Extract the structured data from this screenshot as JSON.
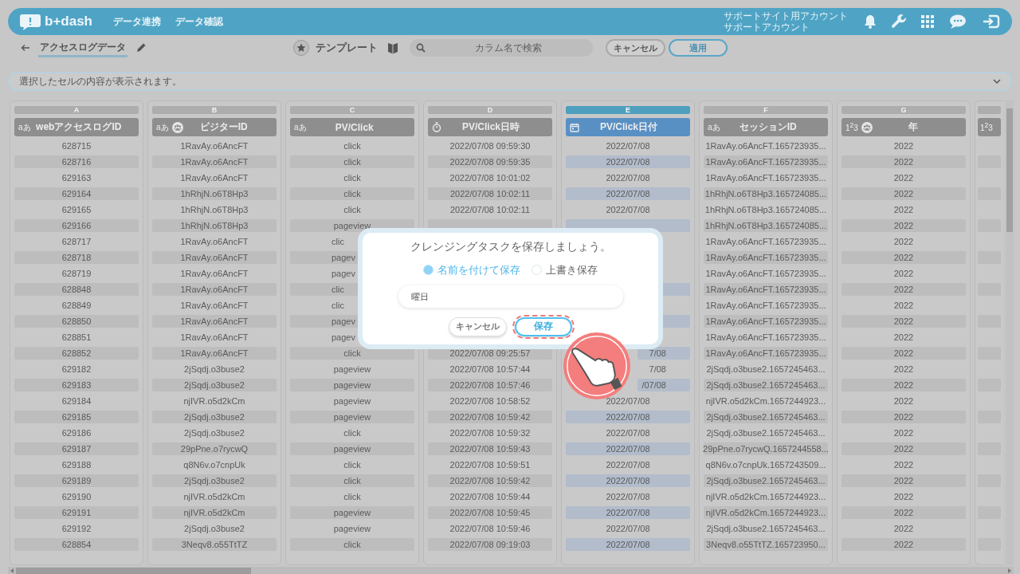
{
  "header": {
    "logo": "b+dash",
    "menu": [
      "データ連携",
      "データ確認"
    ],
    "account": [
      "サポートサイト用アカウント",
      "サポートアカウント"
    ]
  },
  "toolbar": {
    "dataset": "アクセスログデータ",
    "template": "テンプレート",
    "search": {
      "placeholder": "カラム名で検索"
    },
    "buttons": [
      {
        "label": "キャンセル",
        "kind": "plain"
      },
      {
        "label": "適用",
        "kind": "primary"
      }
    ]
  },
  "cell_viewer": {
    "placeholder": "選択したセルの内容が表示されます。"
  },
  "columns": [
    {
      "letter": "A",
      "title": "webアクセスログID",
      "kind": "text",
      "type_mark": "aあ",
      "grouped": false,
      "selected": false
    },
    {
      "letter": "B",
      "title": "ビジターID",
      "kind": "text",
      "type_mark": "aあ",
      "grouped": true,
      "selected": false
    },
    {
      "letter": "C",
      "title": "PV/Click",
      "kind": "text",
      "type_mark": "aあ",
      "grouped": false,
      "selected": false
    },
    {
      "letter": "D",
      "title": "PV/Click日時",
      "kind": "datetime",
      "grouped": false,
      "selected": false
    },
    {
      "letter": "E",
      "title": "PV/Click日付",
      "kind": "date",
      "grouped": false,
      "selected": true
    },
    {
      "letter": "F",
      "title": "セッションID",
      "kind": "text",
      "type_mark": "aあ",
      "grouped": false,
      "selected": false
    },
    {
      "letter": "G",
      "title": "年",
      "kind": "number",
      "type_mark": "1$^{2}$3",
      "grouped": true,
      "selected": false
    },
    {
      "kind": "number",
      "type_mark": "1$^{2}$3",
      "grouped": false,
      "selected": false
    }
  ],
  "rows": [
    {
      "cells": [
        "628715",
        "1RavAy.o6AncFT",
        "click",
        "2022/07/08 09:59:30",
        "2022/07/08",
        "1RavAy.o6AncFT.165723935...",
        "2022"
      ]
    },
    {
      "cells": [
        "628716",
        "1RavAy.o6AncFT",
        "click",
        "2022/07/08 09:59:35",
        "2022/07/08",
        "1RavAy.o6AncFT.165723935...",
        "2022"
      ]
    },
    {
      "cells": [
        "629163",
        "1RavAy.o6AncFT",
        "click",
        "2022/07/08 10:01:02",
        "2022/07/08",
        "1RavAy.o6AncFT.165723935...",
        "2022"
      ]
    },
    {
      "cells": [
        "629164",
        "1hRhjN.o6T8Hp3",
        "click",
        "2022/07/08 10:02:11",
        "2022/07/08",
        "1hRhjN.o6T8Hp3.165724085...",
        "2022"
      ]
    },
    {
      "cells": [
        "629165",
        "1hRhjN.o6T8Hp3",
        "click",
        "2022/07/08 10:02:11",
        "2022/07/08",
        "1hRhjN.o6T8Hp3.165724085...",
        "2022"
      ]
    },
    {
      "cells": [
        "629166",
        "1hRhjN.o6T8Hp3",
        "pageview",
        {
          "kind": "covered"
        },
        {
          "kind": "covered"
        },
        "1hRhjN.o6T8Hp3.165724085...",
        "2022"
      ]
    },
    {
      "cells": [
        "628717",
        "1RavAy.o6AncFT",
        {
          "text": "clic",
          "kind": "cut-end"
        },
        null,
        {
          "kind": "covered"
        },
        "1RavAy.o6AncFT.165723935...",
        "2022"
      ]
    },
    {
      "cells": [
        "628718",
        "1RavAy.o6AncFT",
        {
          "text": "pagev",
          "kind": "cut-end"
        },
        null,
        null,
        "1RavAy.o6AncFT.165723935...",
        "2022"
      ]
    },
    {
      "cells": [
        "628719",
        "1RavAy.o6AncFT",
        {
          "text": "pagev",
          "kind": "cut-end"
        },
        null,
        null,
        "1RavAy.o6AncFT.165723935...",
        "2022"
      ]
    },
    {
      "cells": [
        "628848",
        "1RavAy.o6AncFT",
        {
          "text": "clic",
          "kind": "cut-end"
        },
        null,
        {
          "kind": "covered"
        },
        "1RavAy.o6AncFT.165723935...",
        "2022"
      ]
    },
    {
      "cells": [
        "628849",
        "1RavAy.o6AncFT",
        {
          "text": "clic",
          "kind": "cut-end"
        },
        null,
        null,
        "1RavAy.o6AncFT.165723935...",
        "2022"
      ]
    },
    {
      "cells": [
        "628850",
        "1RavAy.o6AncFT",
        {
          "text": "pagev",
          "kind": "cut-end"
        },
        null,
        {
          "kind": "covered"
        },
        "1RavAy.o6AncFT.165723935...",
        "2022"
      ]
    },
    {
      "cells": [
        "628851",
        "1RavAy.o6AncFT",
        {
          "text": "pagev",
          "kind": "cut-end"
        },
        null,
        null,
        "1RavAy.o6AncFT.165723935...",
        "2022"
      ]
    },
    {
      "cells": [
        "628852",
        "1RavAy.o6AncFT",
        "click",
        "2022/07/08 09:25:57",
        {
          "text": "7/08",
          "kind": "cut-start"
        },
        "1RavAy.o6AncFT.165723935...",
        "2022"
      ]
    },
    {
      "cells": [
        "629182",
        "2jSqdj.o3buse2",
        "pageview",
        "2022/07/08 10:57:44",
        {
          "text": "7/08",
          "kind": "cut-start"
        },
        "2jSqdj.o3buse2.1657245463...",
        "2022"
      ]
    },
    {
      "cells": [
        "629183",
        "2jSqdj.o3buse2",
        "pageview",
        "2022/07/08 10:57:46",
        {
          "text": "/07/08",
          "kind": "cut-start"
        },
        "2jSqdj.o3buse2.1657245463...",
        "2022"
      ]
    },
    {
      "cells": [
        "629184",
        "njIVR.o5d2kCm",
        "pageview",
        "2022/07/08 10:58:52",
        "2022/07/08",
        "njIVR.o5d2kCm.1657244923...",
        "2022"
      ]
    },
    {
      "cells": [
        "629185",
        "2jSqdj.o3buse2",
        "pageview",
        "2022/07/08 10:59:42",
        "2022/07/08",
        "2jSqdj.o3buse2.1657245463...",
        "2022"
      ]
    },
    {
      "cells": [
        "629186",
        "2jSqdj.o3buse2",
        "click",
        "2022/07/08 10:59:32",
        "2022/07/08",
        "2jSqdj.o3buse2.1657245463...",
        "2022"
      ]
    },
    {
      "cells": [
        "629187",
        "29pPne.o7rycwQ",
        "pageview",
        "2022/07/08 10:59:43",
        "2022/07/08",
        "29pPne.o7rycwQ.1657244558...",
        "2022"
      ]
    },
    {
      "cells": [
        "629188",
        "q8N6v.o7cnpUk",
        "click",
        "2022/07/08 10:59:51",
        "2022/07/08",
        "q8N6v.o7cnpUk.1657243509...",
        "2022"
      ]
    },
    {
      "cells": [
        "629189",
        "2jSqdj.o3buse2",
        "click",
        "2022/07/08 10:59:42",
        "2022/07/08",
        "2jSqdj.o3buse2.1657245463...",
        "2022"
      ]
    },
    {
      "cells": [
        "629190",
        "njIVR.o5d2kCm",
        "click",
        "2022/07/08 10:59:44",
        "2022/07/08",
        "njIVR.o5d2kCm.1657244923...",
        "2022"
      ]
    },
    {
      "cells": [
        "629191",
        "njIVR.o5d2kCm",
        "pageview",
        "2022/07/08 10:59:45",
        "2022/07/08",
        "njIVR.o5d2kCm.1657244923...",
        "2022"
      ]
    },
    {
      "cells": [
        "629192",
        "2jSqdj.o3buse2",
        "pageview",
        "2022/07/08 10:59:46",
        "2022/07/08",
        "2jSqdj.o3buse2.1657245463...",
        "2022"
      ]
    },
    {
      "cells": [
        "628854",
        "3Neqv8.o55TtTZ",
        "click",
        "2022/07/08 09:19:03",
        "2022/07/08",
        "3Neqv8.o55TtTZ.165723950...",
        "2022"
      ]
    }
  ],
  "dialog": {
    "title": "クレンジングタスクを保存しましょう。",
    "options": [
      {
        "label": "名前を付けて保存",
        "selected": true
      },
      {
        "label": "上書き保存",
        "selected": false
      }
    ],
    "name_field": {
      "value": "曜日"
    },
    "buttons": [
      {
        "label": "キャンセル",
        "kind": "plain"
      },
      {
        "label": "保存",
        "kind": "primary",
        "highlighted": true
      }
    ]
  }
}
